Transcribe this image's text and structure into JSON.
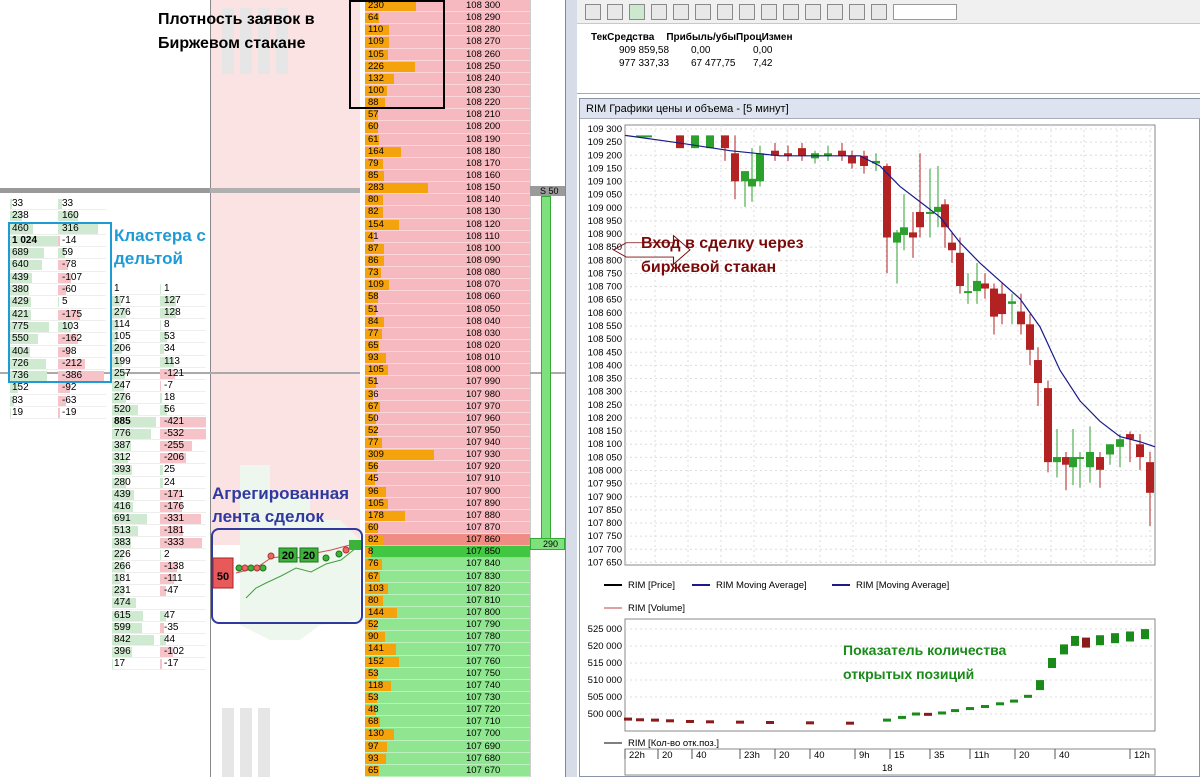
{
  "annotations": {
    "order_density": [
      "Плотность заявок в",
      "Биржевом  стакане"
    ],
    "clusters": [
      "Кластера с",
      "дельтой"
    ],
    "tape": [
      "Агрегированная",
      "лента сделок"
    ],
    "entry": [
      "Вход в сделку через",
      "биржевой стакан"
    ],
    "oi": [
      "Показатель количества",
      "открытых позиций"
    ]
  },
  "cluster_table_a": [
    [
      "33",
      "33"
    ],
    [
      "238",
      "160"
    ],
    [
      "460",
      "316"
    ],
    [
      "1 024",
      "-14"
    ],
    [
      "689",
      "59"
    ],
    [
      "640",
      "-78"
    ],
    [
      "439",
      "-107"
    ],
    [
      "380",
      "-60"
    ],
    [
      "429",
      "5"
    ],
    [
      "421",
      "-175"
    ],
    [
      "775",
      "103"
    ],
    [
      "550",
      "-162"
    ],
    [
      "404",
      "-98"
    ],
    [
      "726",
      "-212"
    ],
    [
      "736",
      "-386"
    ],
    [
      "152",
      "-92"
    ],
    [
      "83",
      "-63"
    ],
    [
      "19",
      "-19"
    ]
  ],
  "cluster_table_b": [
    [
      "1",
      "1"
    ],
    [
      "171",
      "127"
    ],
    [
      "276",
      "128"
    ],
    [
      "114",
      "8"
    ],
    [
      "105",
      "53"
    ],
    [
      "206",
      "34"
    ],
    [
      "199",
      "113"
    ],
    [
      "257",
      "-121"
    ],
    [
      "247",
      "-7"
    ],
    [
      "276",
      "18"
    ],
    [
      "520",
      "56"
    ],
    [
      "885",
      "-421"
    ],
    [
      "776",
      "-532"
    ],
    [
      "387",
      "-255"
    ],
    [
      "312",
      "-206"
    ],
    [
      "393",
      "25"
    ],
    [
      "280",
      "24"
    ],
    [
      "439",
      "-171"
    ],
    [
      "416",
      "-176"
    ],
    [
      "691",
      "-331"
    ],
    [
      "513",
      "-181"
    ],
    [
      "383",
      "-333"
    ],
    [
      "226",
      "2"
    ],
    [
      "266",
      "-138"
    ],
    [
      "181",
      "-111"
    ],
    [
      "231",
      "-47"
    ],
    [
      "474",
      ""
    ],
    [
      "615",
      "47"
    ],
    [
      "599",
      "-35"
    ],
    [
      "842",
      "44"
    ],
    [
      "396",
      "-102"
    ],
    [
      "17",
      "-17"
    ]
  ],
  "dom_rows": [
    {
      "vol": "230",
      "price": "108 300"
    },
    {
      "vol": "64",
      "price": "108 290"
    },
    {
      "vol": "110",
      "price": "108 280"
    },
    {
      "vol": "109",
      "price": "108 270"
    },
    {
      "vol": "105",
      "price": "108 260"
    },
    {
      "vol": "226",
      "price": "108 250"
    },
    {
      "vol": "132",
      "price": "108 240"
    },
    {
      "vol": "100",
      "price": "108 230"
    },
    {
      "vol": "88",
      "price": "108 220"
    },
    {
      "vol": "57",
      "price": "108 210"
    },
    {
      "vol": "60",
      "price": "108 200"
    },
    {
      "vol": "61",
      "price": "108 190"
    },
    {
      "vol": "164",
      "price": "108 180"
    },
    {
      "vol": "79",
      "price": "108 170"
    },
    {
      "vol": "85",
      "price": "108 160"
    },
    {
      "vol": "283",
      "price": "108 150"
    },
    {
      "vol": "80",
      "price": "108 140"
    },
    {
      "vol": "82",
      "price": "108 130"
    },
    {
      "vol": "154",
      "price": "108 120"
    },
    {
      "vol": "41",
      "price": "108 110"
    },
    {
      "vol": "87",
      "price": "108 100"
    },
    {
      "vol": "86",
      "price": "108 090"
    },
    {
      "vol": "73",
      "price": "108 080"
    },
    {
      "vol": "109",
      "price": "108 070"
    },
    {
      "vol": "58",
      "price": "108 060"
    },
    {
      "vol": "51",
      "price": "108 050"
    },
    {
      "vol": "84",
      "price": "108 040"
    },
    {
      "vol": "77",
      "price": "108 030"
    },
    {
      "vol": "65",
      "price": "108 020"
    },
    {
      "vol": "93",
      "price": "108 010"
    },
    {
      "vol": "105",
      "price": "108 000"
    },
    {
      "vol": "51",
      "price": "107 990"
    },
    {
      "vol": "36",
      "price": "107 980"
    },
    {
      "vol": "67",
      "price": "107 970"
    },
    {
      "vol": "50",
      "price": "107 960"
    },
    {
      "vol": "52",
      "price": "107 950"
    },
    {
      "vol": "77",
      "price": "107 940"
    },
    {
      "vol": "309",
      "price": "107 930"
    },
    {
      "vol": "56",
      "price": "107 920"
    },
    {
      "vol": "45",
      "price": "107 910"
    },
    {
      "vol": "96",
      "price": "107 900"
    },
    {
      "vol": "105",
      "price": "107 890"
    },
    {
      "vol": "178",
      "price": "107 880"
    },
    {
      "vol": "60",
      "price": "107 870"
    },
    {
      "vol": "82",
      "price": "107 860"
    },
    {
      "vol": "8",
      "price": "107 850"
    },
    {
      "vol": "76",
      "price": "107 840"
    },
    {
      "vol": "67",
      "price": "107 830"
    },
    {
      "vol": "103",
      "price": "107 820"
    },
    {
      "vol": "80",
      "price": "107 810"
    },
    {
      "vol": "144",
      "price": "107 800"
    },
    {
      "vol": "52",
      "price": "107 790"
    },
    {
      "vol": "90",
      "price": "107 780"
    },
    {
      "vol": "141",
      "price": "107 770"
    },
    {
      "vol": "152",
      "price": "107 760"
    },
    {
      "vol": "53",
      "price": "107 750"
    },
    {
      "vol": "118",
      "price": "107 740"
    },
    {
      "vol": "53",
      "price": "107 730"
    },
    {
      "vol": "48",
      "price": "107 720"
    },
    {
      "vol": "68",
      "price": "107 710"
    },
    {
      "vol": "130",
      "price": "107 700"
    },
    {
      "vol": "97",
      "price": "107 690"
    },
    {
      "vol": "93",
      "price": "107 680"
    },
    {
      "vol": "65",
      "price": "107 670"
    }
  ],
  "dom_markers": {
    "sell": "S 50",
    "buy": "290"
  },
  "tape_labels": {
    "big": "50",
    "a": "20",
    "b": "20"
  },
  "account": {
    "headers": [
      "ТекСредства",
      "Прибыль/убы",
      "Проц",
      "Измен"
    ],
    "rows": [
      [
        "909 859,58",
        "0,00",
        "0,00"
      ],
      [
        "977 337,33",
        "67 477,75",
        "7,42"
      ]
    ]
  },
  "chart_window_title": "RIM   Графики цены и объема - [5 минут]",
  "price_ticks": [
    "109 300",
    "109 250",
    "109 200",
    "109 150",
    "109 100",
    "109 050",
    "109 000",
    "108 950",
    "108 900",
    "108 850",
    "108 800",
    "108 750",
    "108 700",
    "108 650",
    "108 600",
    "108 550",
    "108 500",
    "108 450",
    "108 400",
    "108 350",
    "108 300",
    "108 250",
    "108 200",
    "108 150",
    "108 100",
    "108 050",
    "108 000",
    "107 950",
    "107 900",
    "107 850",
    "107 800",
    "107 750",
    "107 700",
    "107 650"
  ],
  "legend_price": [
    "RIM  [Price]",
    "RIM  Moving Average]",
    "RIM  [Moving Average]"
  ],
  "legend_volume": "RIM  [Volume]",
  "legend_oi": "RIM  [Кол-во отк.поз.]",
  "oi_ticks": [
    "525 000",
    "520 000",
    "515 000",
    "510 000",
    "505 000",
    "500 000"
  ],
  "time_ticks": [
    "22h",
    "20",
    "40",
    "23h",
    "20",
    "40",
    "9h",
    "15",
    "35",
    "11h",
    "20",
    "40",
    "12h"
  ],
  "time_sub": "18",
  "colors": {
    "bull": "#2ca02c",
    "bear": "#b22222",
    "ma": "#1a1a8c",
    "oi": "#1a8a1a",
    "annotation_dark_red": "#7a0a0a"
  }
}
